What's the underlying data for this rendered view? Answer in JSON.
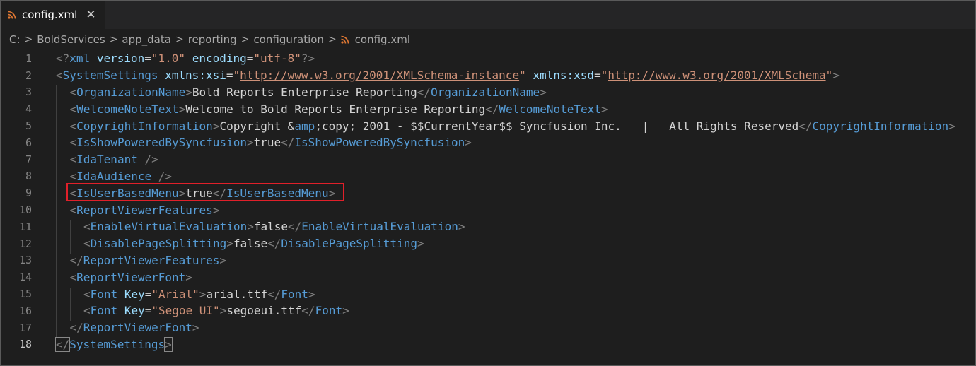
{
  "tab": {
    "title": "config.xml",
    "close_glyph": "✕",
    "icon": "rss-icon"
  },
  "breadcrumb": {
    "items": [
      "C:",
      "BoldServices",
      "app_data",
      "reporting",
      "configuration"
    ],
    "file": "config.xml",
    "separator": ">"
  },
  "colors": {
    "tag": "#569cd6",
    "attribute": "#9cdcfe",
    "string": "#ce9178",
    "bracket": "#808080",
    "text": "#d4d4d4",
    "highlight_box": "#e0202a"
  },
  "editor": {
    "active_line": 18,
    "highlighted_line": 9,
    "lines": [
      {
        "n": "1",
        "tokens": [
          {
            "c": "b",
            "v": "<?"
          },
          {
            "c": "t",
            "v": "xml"
          },
          {
            "c": "x",
            "v": " "
          },
          {
            "c": "a",
            "v": "version"
          },
          {
            "c": "x",
            "v": "="
          },
          {
            "c": "s",
            "v": "\"1.0\""
          },
          {
            "c": "x",
            "v": " "
          },
          {
            "c": "a",
            "v": "encoding"
          },
          {
            "c": "x",
            "v": "="
          },
          {
            "c": "s",
            "v": "\"utf-8\""
          },
          {
            "c": "b",
            "v": "?>"
          }
        ]
      },
      {
        "n": "2",
        "tokens": [
          {
            "c": "b",
            "v": "<"
          },
          {
            "c": "t",
            "v": "SystemSettings"
          },
          {
            "c": "x",
            "v": " "
          },
          {
            "c": "a",
            "v": "xmlns:xsi"
          },
          {
            "c": "x",
            "v": "="
          },
          {
            "c": "s",
            "v": "\""
          },
          {
            "c": "u",
            "v": "http://www.w3.org/2001/XMLSchema-instance"
          },
          {
            "c": "s",
            "v": "\""
          },
          {
            "c": "x",
            "v": " "
          },
          {
            "c": "a",
            "v": "xmlns:xsd"
          },
          {
            "c": "x",
            "v": "="
          },
          {
            "c": "s",
            "v": "\""
          },
          {
            "c": "u",
            "v": "http://www.w3.org/2001/XMLSchema"
          },
          {
            "c": "s",
            "v": "\""
          },
          {
            "c": "b",
            "v": ">"
          }
        ]
      },
      {
        "n": "3",
        "indent": 1,
        "tokens": [
          {
            "c": "b",
            "v": "<"
          },
          {
            "c": "t",
            "v": "OrganizationName"
          },
          {
            "c": "b",
            "v": ">"
          },
          {
            "c": "x",
            "v": "Bold Reports Enterprise Reporting"
          },
          {
            "c": "b",
            "v": "</"
          },
          {
            "c": "t",
            "v": "OrganizationName"
          },
          {
            "c": "b",
            "v": ">"
          }
        ]
      },
      {
        "n": "4",
        "indent": 1,
        "tokens": [
          {
            "c": "b",
            "v": "<"
          },
          {
            "c": "t",
            "v": "WelcomeNoteText"
          },
          {
            "c": "b",
            "v": ">"
          },
          {
            "c": "x",
            "v": "Welcome to Bold Reports Enterprise Reporting"
          },
          {
            "c": "b",
            "v": "</"
          },
          {
            "c": "t",
            "v": "WelcomeNoteText"
          },
          {
            "c": "b",
            "v": ">"
          }
        ]
      },
      {
        "n": "5",
        "indent": 1,
        "tokens": [
          {
            "c": "b",
            "v": "<"
          },
          {
            "c": "t",
            "v": "CopyrightInformation"
          },
          {
            "c": "b",
            "v": ">"
          },
          {
            "c": "x",
            "v": "Copyright &"
          },
          {
            "c": "t",
            "v": "amp"
          },
          {
            "c": "x",
            "v": ";copy; 2001 - $$CurrentYear$$ Syncfusion Inc.   |   All Rights Reserved"
          },
          {
            "c": "b",
            "v": "</"
          },
          {
            "c": "t",
            "v": "CopyrightInformation"
          },
          {
            "c": "b",
            "v": ">"
          }
        ]
      },
      {
        "n": "6",
        "indent": 1,
        "tokens": [
          {
            "c": "b",
            "v": "<"
          },
          {
            "c": "t",
            "v": "IsShowPoweredBySyncfusion"
          },
          {
            "c": "b",
            "v": ">"
          },
          {
            "c": "x",
            "v": "true"
          },
          {
            "c": "b",
            "v": "</"
          },
          {
            "c": "t",
            "v": "IsShowPoweredBySyncfusion"
          },
          {
            "c": "b",
            "v": ">"
          }
        ]
      },
      {
        "n": "7",
        "indent": 1,
        "tokens": [
          {
            "c": "b",
            "v": "<"
          },
          {
            "c": "t",
            "v": "IdaTenant"
          },
          {
            "c": "x",
            "v": " "
          },
          {
            "c": "b",
            "v": "/>"
          }
        ]
      },
      {
        "n": "8",
        "indent": 1,
        "tokens": [
          {
            "c": "b",
            "v": "<"
          },
          {
            "c": "t",
            "v": "IdaAudience"
          },
          {
            "c": "x",
            "v": " "
          },
          {
            "c": "b",
            "v": "/>"
          }
        ]
      },
      {
        "n": "9",
        "indent": 1,
        "tokens": [
          {
            "c": "b",
            "v": "<"
          },
          {
            "c": "t",
            "v": "IsUserBasedMenu"
          },
          {
            "c": "b",
            "v": ">"
          },
          {
            "c": "x",
            "v": "true"
          },
          {
            "c": "b",
            "v": "</"
          },
          {
            "c": "t",
            "v": "IsUserBasedMenu"
          },
          {
            "c": "b",
            "v": ">"
          }
        ]
      },
      {
        "n": "10",
        "indent": 1,
        "tokens": [
          {
            "c": "b",
            "v": "<"
          },
          {
            "c": "t",
            "v": "ReportViewerFeatures"
          },
          {
            "c": "b",
            "v": ">"
          }
        ]
      },
      {
        "n": "11",
        "indent": 2,
        "tokens": [
          {
            "c": "b",
            "v": "<"
          },
          {
            "c": "t",
            "v": "EnableVirtualEvaluation"
          },
          {
            "c": "b",
            "v": ">"
          },
          {
            "c": "x",
            "v": "false"
          },
          {
            "c": "b",
            "v": "</"
          },
          {
            "c": "t",
            "v": "EnableVirtualEvaluation"
          },
          {
            "c": "b",
            "v": ">"
          }
        ]
      },
      {
        "n": "12",
        "indent": 2,
        "tokens": [
          {
            "c": "b",
            "v": "<"
          },
          {
            "c": "t",
            "v": "DisablePageSplitting"
          },
          {
            "c": "b",
            "v": ">"
          },
          {
            "c": "x",
            "v": "false"
          },
          {
            "c": "b",
            "v": "</"
          },
          {
            "c": "t",
            "v": "DisablePageSplitting"
          },
          {
            "c": "b",
            "v": ">"
          }
        ]
      },
      {
        "n": "13",
        "indent": 1,
        "tokens": [
          {
            "c": "b",
            "v": "</"
          },
          {
            "c": "t",
            "v": "ReportViewerFeatures"
          },
          {
            "c": "b",
            "v": ">"
          }
        ]
      },
      {
        "n": "14",
        "indent": 1,
        "tokens": [
          {
            "c": "b",
            "v": "<"
          },
          {
            "c": "t",
            "v": "ReportViewerFont"
          },
          {
            "c": "b",
            "v": ">"
          }
        ]
      },
      {
        "n": "15",
        "indent": 2,
        "tokens": [
          {
            "c": "b",
            "v": "<"
          },
          {
            "c": "t",
            "v": "Font"
          },
          {
            "c": "x",
            "v": " "
          },
          {
            "c": "a",
            "v": "Key"
          },
          {
            "c": "x",
            "v": "="
          },
          {
            "c": "s",
            "v": "\"Arial\""
          },
          {
            "c": "b",
            "v": ">"
          },
          {
            "c": "x",
            "v": "arial.ttf"
          },
          {
            "c": "b",
            "v": "</"
          },
          {
            "c": "t",
            "v": "Font"
          },
          {
            "c": "b",
            "v": ">"
          }
        ]
      },
      {
        "n": "16",
        "indent": 2,
        "tokens": [
          {
            "c": "b",
            "v": "<"
          },
          {
            "c": "t",
            "v": "Font"
          },
          {
            "c": "x",
            "v": " "
          },
          {
            "c": "a",
            "v": "Key"
          },
          {
            "c": "x",
            "v": "="
          },
          {
            "c": "s",
            "v": "\"Segoe UI\""
          },
          {
            "c": "b",
            "v": ">"
          },
          {
            "c": "x",
            "v": "segoeui.ttf"
          },
          {
            "c": "b",
            "v": "</"
          },
          {
            "c": "t",
            "v": "Font"
          },
          {
            "c": "b",
            "v": ">"
          }
        ]
      },
      {
        "n": "17",
        "indent": 1,
        "tokens": [
          {
            "c": "b",
            "v": "</"
          },
          {
            "c": "t",
            "v": "ReportViewerFont"
          },
          {
            "c": "b",
            "v": ">"
          }
        ]
      },
      {
        "n": "18",
        "tokens": [
          {
            "c": "b cur",
            "v": "</"
          },
          {
            "c": "t",
            "v": "SystemSettings"
          },
          {
            "c": "b cur",
            "v": ">"
          }
        ]
      }
    ]
  }
}
